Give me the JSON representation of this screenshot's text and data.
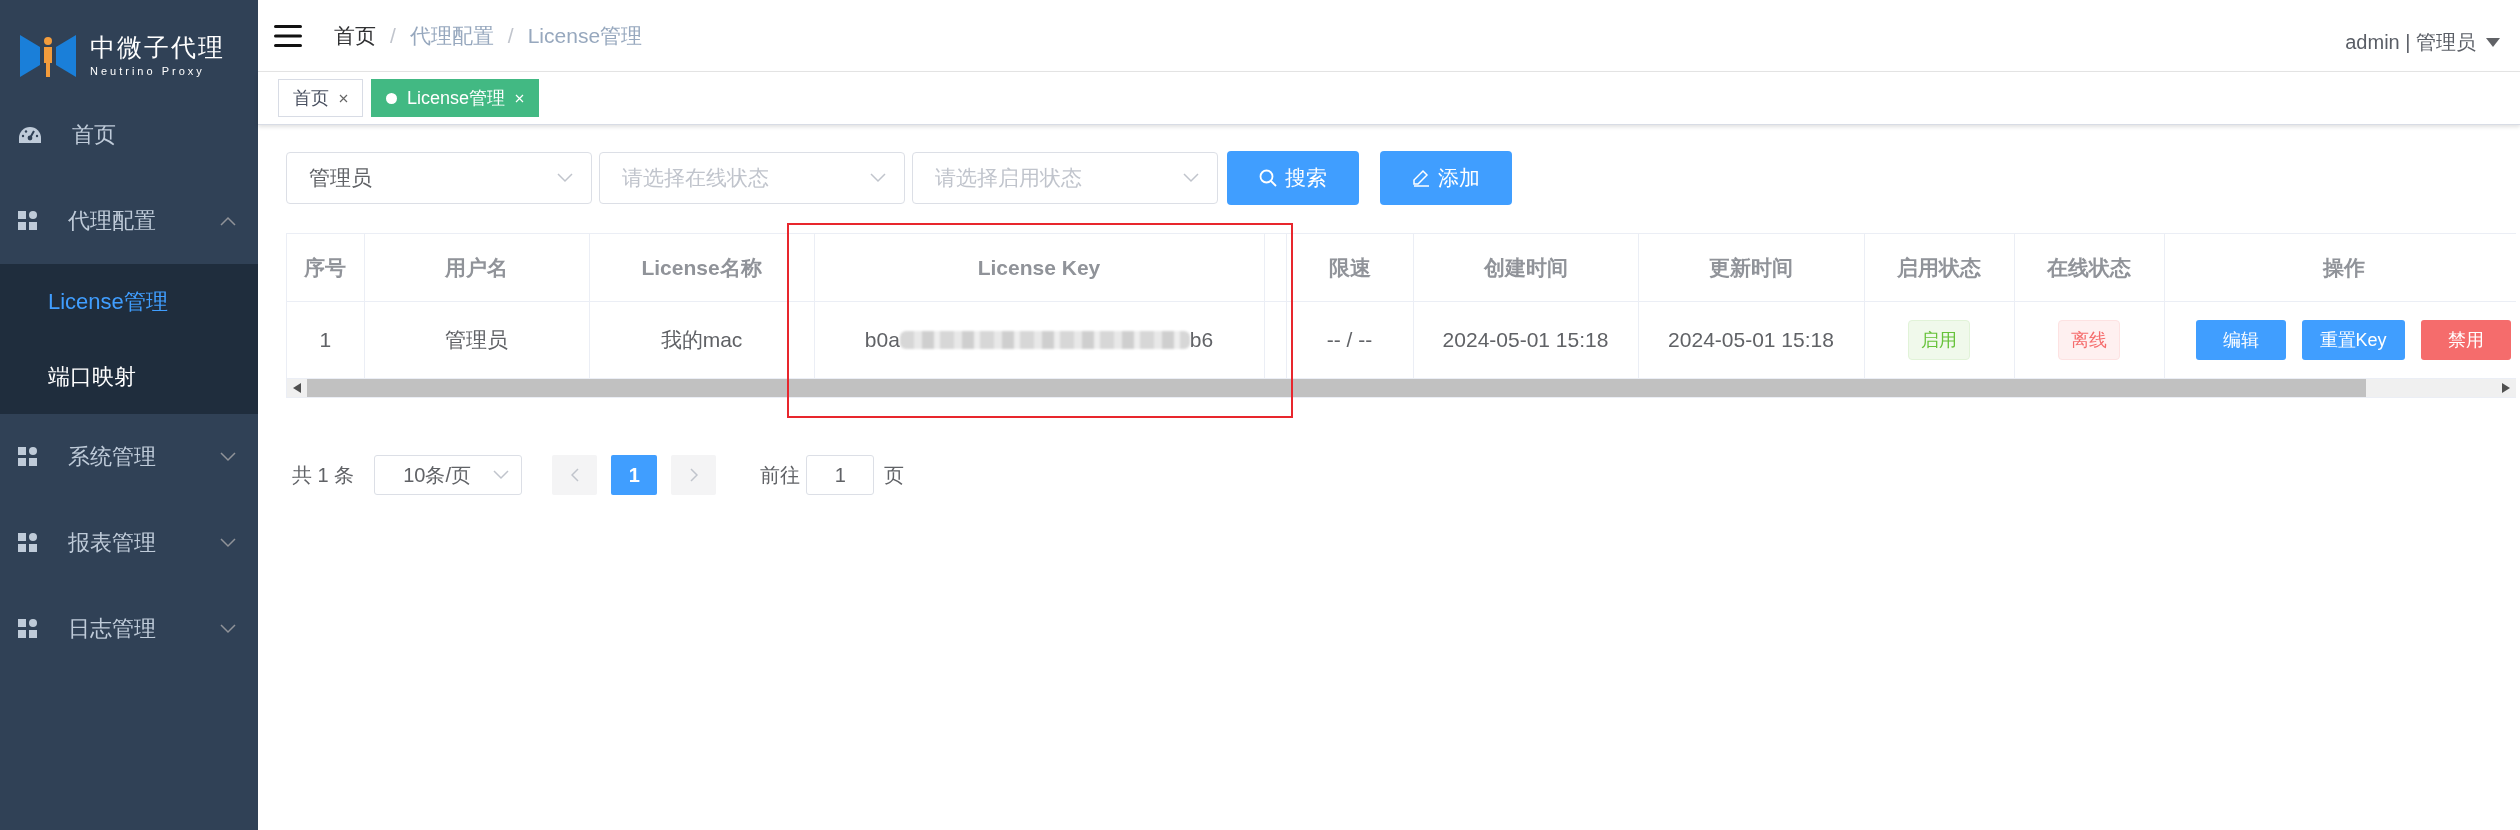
{
  "logo": {
    "title": "中微子代理",
    "subtitle": "Neutrino Proxy"
  },
  "sidebar": {
    "items": [
      {
        "label": "首页",
        "kind": "link"
      },
      {
        "label": "代理配置",
        "kind": "group",
        "expanded": true,
        "children": [
          {
            "label": "License管理",
            "selected": true
          },
          {
            "label": "端口映射",
            "selected": false
          }
        ]
      },
      {
        "label": "系统管理",
        "kind": "group",
        "expanded": false
      },
      {
        "label": "报表管理",
        "kind": "group",
        "expanded": false
      },
      {
        "label": "日志管理",
        "kind": "group",
        "expanded": false
      }
    ]
  },
  "breadcrumb": {
    "separator": "/",
    "items": [
      {
        "label": "首页",
        "link": true
      },
      {
        "label": "代理配置",
        "link": false
      },
      {
        "label": "License管理",
        "link": false
      }
    ]
  },
  "user": {
    "label": "admin | 管理员"
  },
  "tabs": [
    {
      "label": "首页",
      "selected": false
    },
    {
      "label": "License管理",
      "selected": true
    }
  ],
  "filters": [
    {
      "value": "管理员"
    },
    {
      "placeholder": "请选择在线状态"
    },
    {
      "placeholder": "请选择启用状态"
    }
  ],
  "buttons": [
    {
      "label": "搜索",
      "kind": "search"
    },
    {
      "label": "添加",
      "kind": "add"
    }
  ],
  "table": {
    "columns": [
      {
        "label": "序号",
        "highlighted": false
      },
      {
        "label": "用户名",
        "highlighted": false
      },
      {
        "label": "License名称",
        "highlighted": false
      },
      {
        "label": "License Key",
        "highlighted": true
      },
      {
        "label": "限速",
        "highlighted": false
      },
      {
        "label": "创建时间",
        "highlighted": false
      },
      {
        "label": "更新时间",
        "highlighted": false
      },
      {
        "label": "启用状态",
        "highlighted": false
      },
      {
        "label": "在线状态",
        "highlighted": false
      },
      {
        "label": "操作",
        "highlighted": false
      }
    ],
    "rows": [
      {
        "cells": [
          {
            "kind": "text",
            "text": "1"
          },
          {
            "kind": "text",
            "text": "管理员"
          },
          {
            "kind": "text",
            "text": "我的mac"
          },
          {
            "kind": "redacted",
            "start": "b0a",
            "end": "b6"
          },
          {
            "kind": "text",
            "text": "-- / --"
          },
          {
            "kind": "text",
            "text": "2024-05-01 15:18"
          },
          {
            "kind": "text",
            "text": "2024-05-01 15:18"
          },
          {
            "kind": "tag",
            "text": "启用",
            "color": "#67c23a"
          },
          {
            "kind": "tag",
            "text": "离线",
            "color": "#f56c6c"
          },
          {
            "kind": "actions",
            "buttons": [
              {
                "label": "编辑",
                "color": "#409eff"
              },
              {
                "label": "重置Key",
                "color": "#409eff"
              },
              {
                "label": "禁用",
                "color": "#f56c6c"
              }
            ]
          }
        ]
      }
    ]
  },
  "pagination": {
    "total": "共 1 条",
    "page_size": "10条/页",
    "pages": [
      {
        "label": "1",
        "selected": true
      }
    ],
    "goto_label": "前往",
    "goto_value": "1",
    "goto_suffix": "页"
  }
}
